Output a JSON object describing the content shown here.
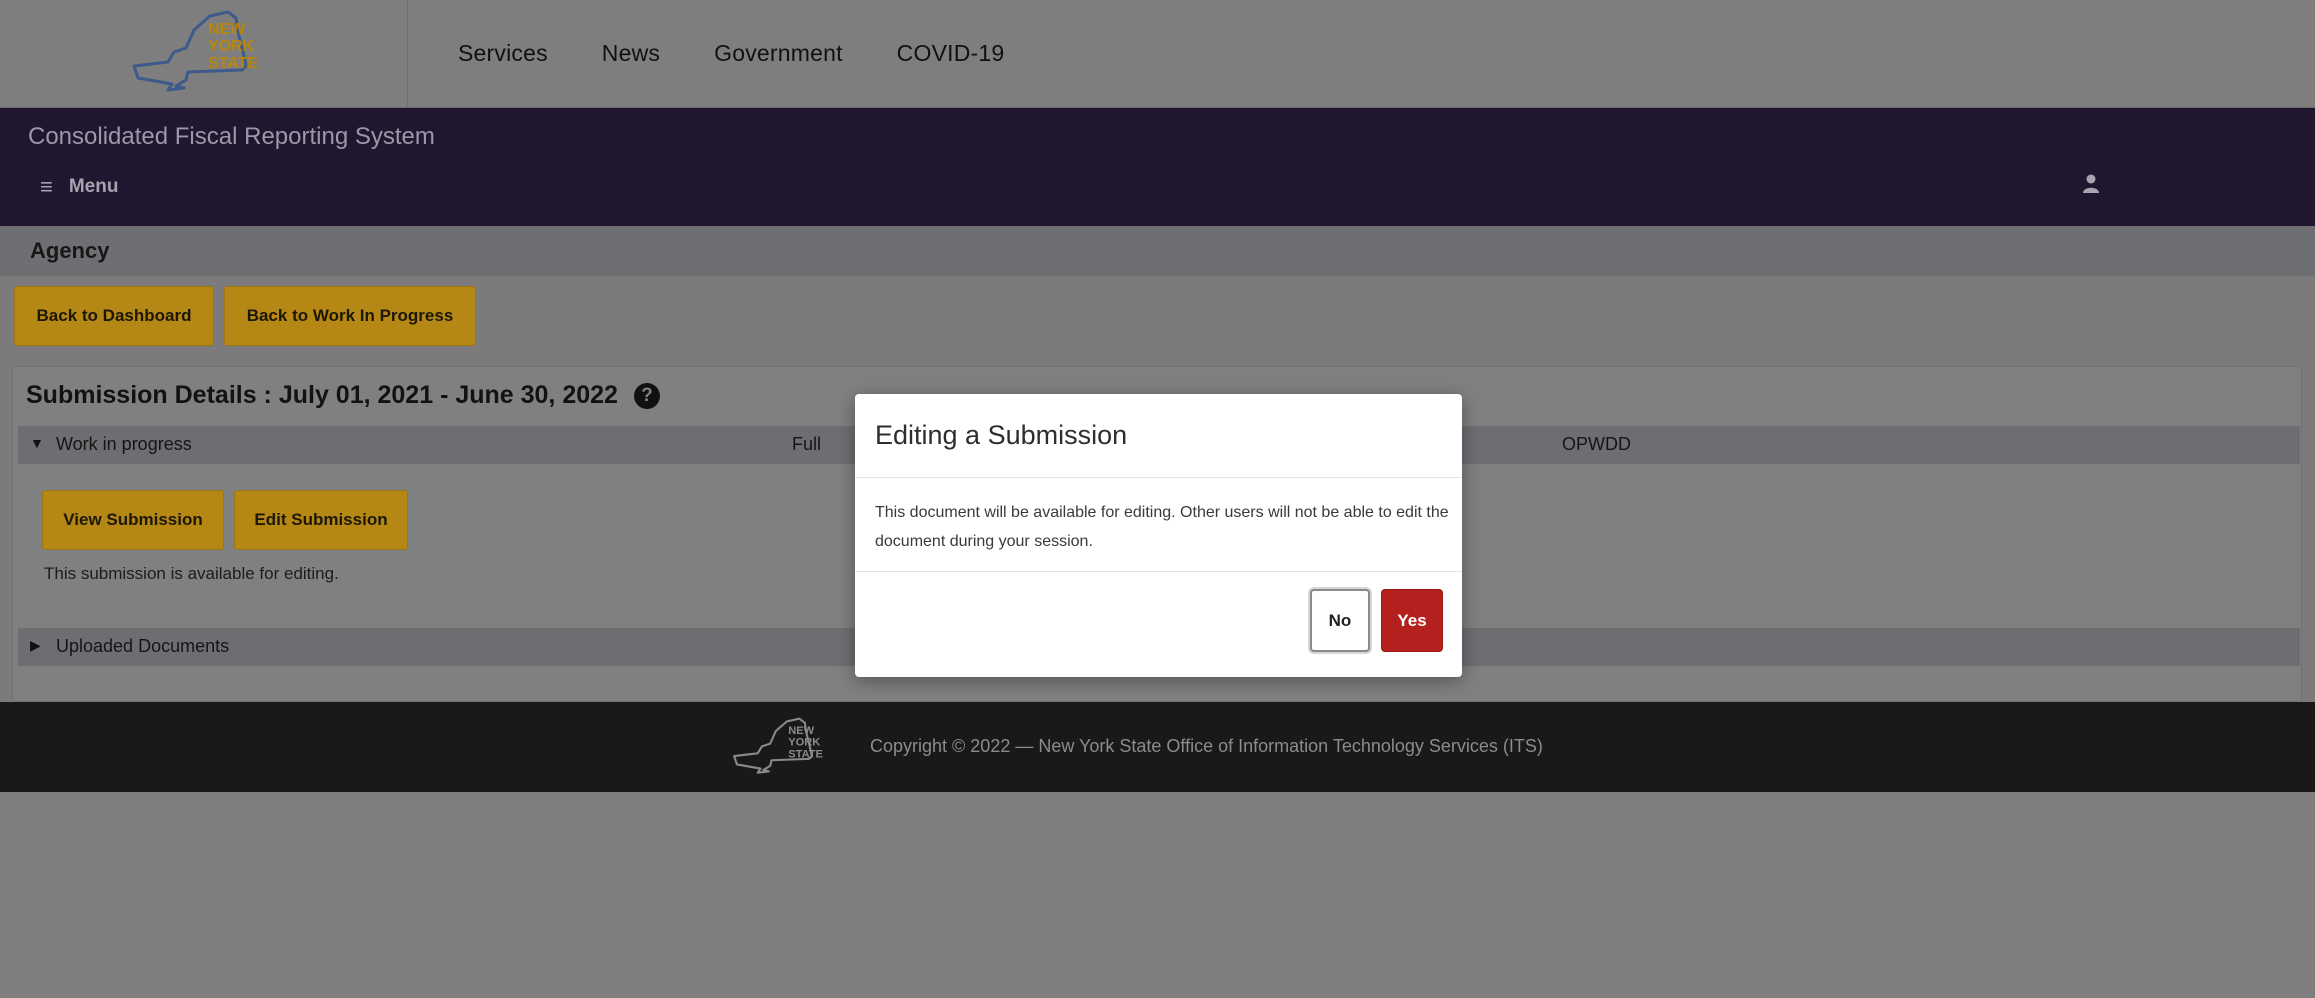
{
  "header": {
    "logo_text": [
      "NEW",
      "YORK",
      "STATE"
    ],
    "nav": [
      {
        "label": "Services"
      },
      {
        "label": "News"
      },
      {
        "label": "Government"
      },
      {
        "label": "COVID-19"
      }
    ]
  },
  "app_bar": {
    "title": "Consolidated Fiscal Reporting System",
    "menu_icon": "≡",
    "menu_label": "Menu",
    "user_icon": "user-icon"
  },
  "agency": {
    "label": "Agency"
  },
  "actions": {
    "back_dashboard": "Back to Dashboard",
    "back_wip": "Back to Work In Progress"
  },
  "submission": {
    "title": "Submission Details : July 01, 2021 - June 30, 2022",
    "help_icon": "?",
    "wip_row": {
      "caret": "▼",
      "label": "Work in progress",
      "type": "Full",
      "agency_code": "OPWDD"
    },
    "view_button": "View Submission",
    "edit_button": "Edit Submission",
    "availability_text": "This submission is available for editing.",
    "uploaded_row": {
      "caret": "▶",
      "label": "Uploaded Documents"
    }
  },
  "footer": {
    "copyright": "Copyright © 2022 — New York State Office of Information Technology Services (ITS)"
  },
  "modal": {
    "title": "Editing a Submission",
    "body": "This document will be available for editing. Other users will not be able to edit the document during your session.",
    "no_label": "No",
    "yes_label": "Yes"
  },
  "colors": {
    "brand_purple": "#211630",
    "gold_button": "#b58715",
    "yes_button": "#b4201e",
    "overlay_gray": "#7d7e7e"
  }
}
